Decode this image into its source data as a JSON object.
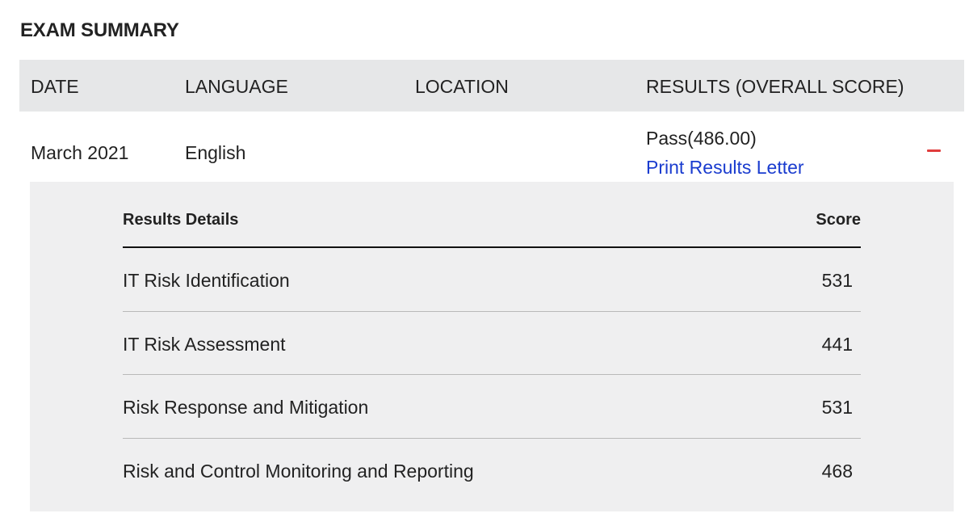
{
  "section_title": "EXAM SUMMARY",
  "table": {
    "headers": {
      "date": "DATE",
      "language": "LANGUAGE",
      "location": "LOCATION",
      "results": "RESULTS (OVERALL SCORE)"
    },
    "row": {
      "date": "March 2021",
      "language": "English",
      "location": "",
      "result": "Pass(486.00)",
      "print_link": "Print Results Letter",
      "collapse_icon": "minus-icon",
      "collapse_color": "#e03c3c"
    }
  },
  "details": {
    "header_label": "Results Details",
    "header_score": "Score",
    "rows": [
      {
        "label": "IT Risk Identification",
        "score": "531"
      },
      {
        "label": "IT Risk Assessment",
        "score": "441"
      },
      {
        "label": "Risk Response and Mitigation",
        "score": "531"
      },
      {
        "label": "Risk and Control Monitoring and Reporting",
        "score": "468"
      }
    ]
  },
  "colors": {
    "header_bg": "#e6e7e8",
    "panel_bg": "#efeff0",
    "link": "#1a3ccf"
  }
}
